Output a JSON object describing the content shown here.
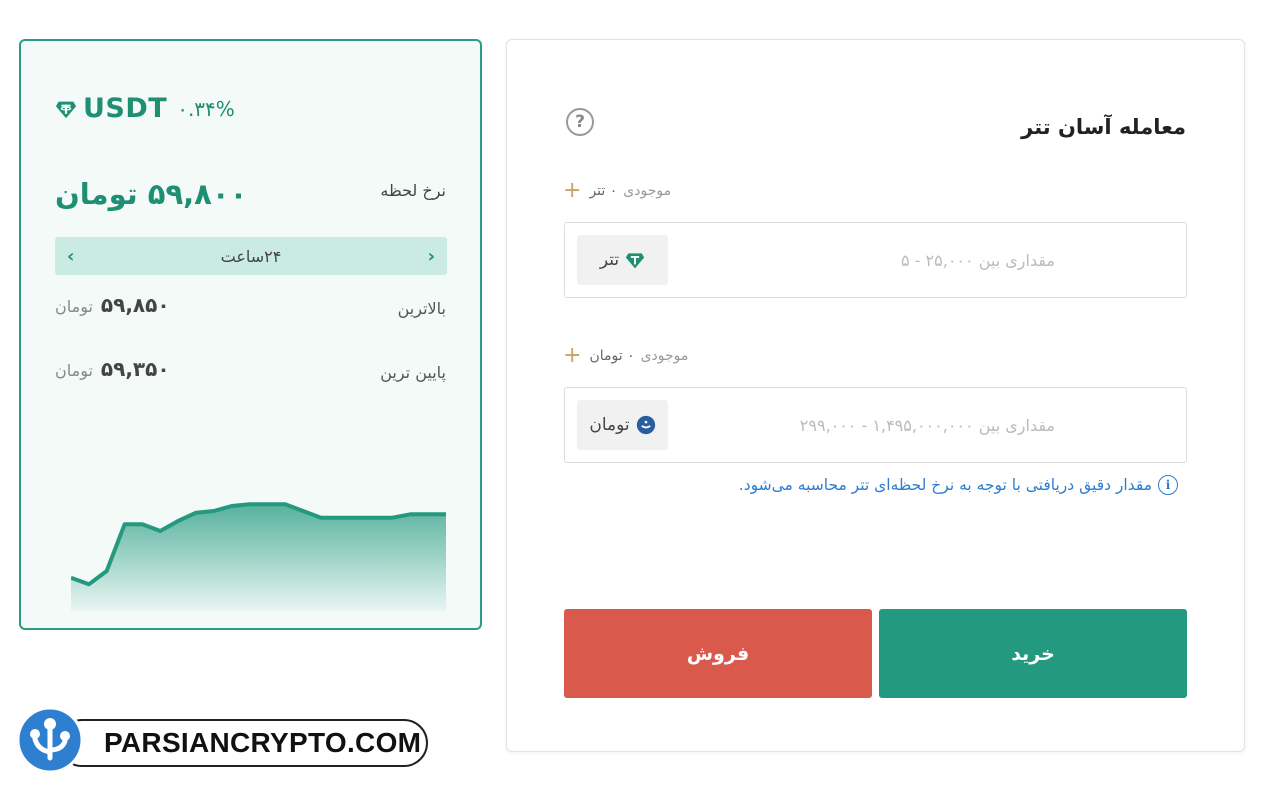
{
  "price_card": {
    "symbol": "USDT",
    "change": "٠.٣۴%",
    "rate_label": "نرخ لحظه",
    "rate_value": "۵۹,۸۰۰ تومان",
    "range": {
      "prev": "‹",
      "label": "۲۴ساعت",
      "next": "›"
    },
    "high": {
      "label": "بالاترین",
      "value": "۵۹,۸۵۰",
      "unit": "تومان"
    },
    "low": {
      "label": "پایین ترین",
      "value": "۵۹,۳۵۰",
      "unit": "تومان"
    },
    "sparkline": [
      59360,
      59320,
      59400,
      59680,
      59680,
      59640,
      59700,
      59750,
      59760,
      59790,
      59800,
      59800,
      59800,
      59760,
      59720,
      59720,
      59720,
      59720,
      59720,
      59740,
      59740,
      59740
    ],
    "colors": {
      "accent": "#23997f",
      "border": "#2a9d84",
      "bg": "#f3faf8"
    }
  },
  "trade": {
    "title": "معامله آسان تتر",
    "help_icon": "?",
    "usdt_field": {
      "balance_label": "موجودی",
      "balance_value": "٠ تتر",
      "placeholder": "مقداری بین ۲۵,۰۰۰ - ۵",
      "unit": "تتر"
    },
    "toman_field": {
      "balance_label": "موجودی",
      "balance_value": "٠ تومان",
      "placeholder": "مقداری بین ۱,۴۹۵,۰۰۰,۰۰۰ - ۲۹۹,۰۰۰",
      "unit": "تومان"
    },
    "info_text": "مقدار دقیق دریافتی با توجه به نرخ لحظه‌ای تتر محاسبه می‌شود.",
    "buy_label": "خرید",
    "sell_label": "فروش",
    "colors": {
      "buy": "#23997f",
      "sell": "#d95a4c",
      "info": "#2d7dd2"
    }
  },
  "watermark": {
    "text": "PARSIANCRYPTO.COM"
  }
}
